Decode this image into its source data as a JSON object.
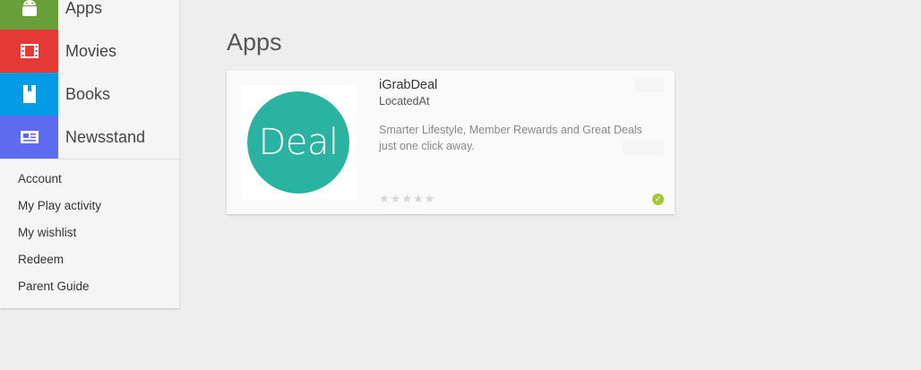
{
  "sidebar": {
    "categories": [
      {
        "label": "Apps",
        "color": "#689f38",
        "icon": "android-icon"
      },
      {
        "label": "Movies",
        "color": "#e53935",
        "icon": "film-icon"
      },
      {
        "label": "Books",
        "color": "#039be5",
        "icon": "book-icon"
      },
      {
        "label": "Newsstand",
        "color": "#5c6bf0",
        "icon": "newspaper-icon"
      }
    ],
    "links": [
      {
        "label": "Account"
      },
      {
        "label": "My Play activity"
      },
      {
        "label": "My wishlist"
      },
      {
        "label": "Redeem"
      },
      {
        "label": "Parent Guide"
      }
    ]
  },
  "main": {
    "section_title": "Apps",
    "app": {
      "title": "iGrabDeal",
      "developer": "LocatedAt",
      "description": "Smarter Lifestyle, Member Rewards and Great Deals just one click away.",
      "icon_text": "Deal",
      "icon_color": "#2bb3a2",
      "rating_stars": 5,
      "installed_color": "#a4c639"
    }
  }
}
